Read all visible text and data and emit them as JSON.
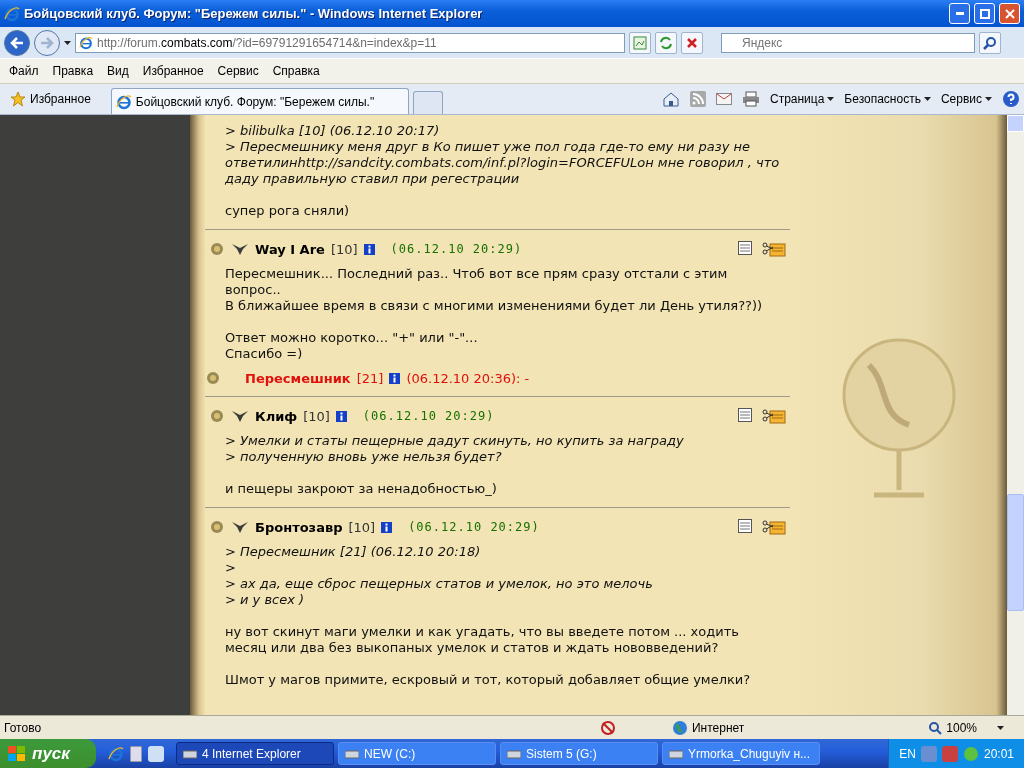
{
  "window": {
    "title": "Бойцовский клуб. Форум: \"Бережем силы.\" - Windows Internet Explorer"
  },
  "address": {
    "url_parts": [
      {
        "text": "http://forum.",
        "highlighted": false
      },
      {
        "text": "combats.com",
        "highlighted": true
      },
      {
        "text": "/?id=69791291654714&n=index&p=11",
        "highlighted": false
      }
    ],
    "search_placeholder": "Яндекс"
  },
  "menu": [
    "Файл",
    "Правка",
    "Вид",
    "Избранное",
    "Сервис",
    "Справка"
  ],
  "favorites": "Избранное",
  "tabs": [
    {
      "label": "Бойцовский клуб. Форум: \"Бережем силы.\"",
      "selected": true
    }
  ],
  "command_bar": [
    "Страница",
    "Безопасность",
    "Сервис"
  ],
  "posts": [
    {
      "body": [
        {
          "kind": "quote",
          "lines": [
            ">   bilibulka [10] (06.12.10 20:17)",
            "> Пересмешнику меня друг в Ко пишет уже пол года где-то ему ни разу не",
            "ответилинhttp://sandcity.combats.com/inf.pl?login=FORCEFULон мне говорил , что",
            "даду правильную ставил при регестрации"
          ]
        },
        {
          "kind": "text",
          "lines": [
            "супер рога сняли)"
          ]
        }
      ]
    },
    {
      "author": "Way I Are",
      "level": "[10]",
      "date": "(06.12.10 20:29)",
      "body": [
        {
          "kind": "text",
          "lines": [
            "Пересмешник... Последний раз.. Чтоб вот все прям сразу отстали с этим",
            "вопрос..",
            "В ближайшее время в связи с многими изменениями будет ли День утиля??))"
          ]
        },
        {
          "kind": "text",
          "lines": [
            "Ответ можно коротко... \"+\" или \"-\"...",
            "Спасибо =)"
          ]
        }
      ],
      "replies": [
        {
          "author": "Пересмешник",
          "level": "[21]",
          "date": "(06.12.10 20:36): -"
        }
      ]
    },
    {
      "author": "Клиф",
      "level": "[10]",
      "date": "(06.12.10 20:29)",
      "body": [
        {
          "kind": "quote",
          "lines": [
            "> Умелки и статы пещерные дадут скинуть, но купить за награду",
            "> полученную вновь уже нельзя будет?"
          ]
        },
        {
          "kind": "text",
          "lines": [
            "и пещеры закроют за ненадобностью_)"
          ]
        }
      ]
    },
    {
      "author": "Бронтозавр",
      "level": "[10]",
      "date": "(06.12.10 20:29)",
      "body": [
        {
          "kind": "quote",
          "lines": [
            "> Пересмешник [21] (06.12.10 20:18)",
            ">",
            "> ах да, еще сброс пещерных статов и умелок, но это мелочь",
            "> и у всех )"
          ]
        },
        {
          "kind": "text",
          "lines": [
            "ну вот скинут маги умелки и как угадать, что вы введете потом ... ходить",
            "месяц или два без выкопаных умелок и статов и ждать нововведений?"
          ]
        },
        {
          "kind": "text",
          "lines": [
            "Шмот у магов примите, ескровый и тот, который добавляет общие умелки?"
          ]
        }
      ]
    }
  ],
  "status_bar": {
    "text": "Готово",
    "zone": "Интернет",
    "zoom": "100%"
  },
  "taskbar": {
    "start": "пуск",
    "tasks": [
      {
        "label": "4 Internet Explorer",
        "selected": true
      },
      {
        "label": "NEW (C:)",
        "selected": false
      },
      {
        "label": "Sistem 5 (G:)",
        "selected": false
      },
      {
        "label": "Yrmorka_Chuguyiv н...",
        "selected": false
      }
    ],
    "language": "EN",
    "clock": "20:01"
  }
}
